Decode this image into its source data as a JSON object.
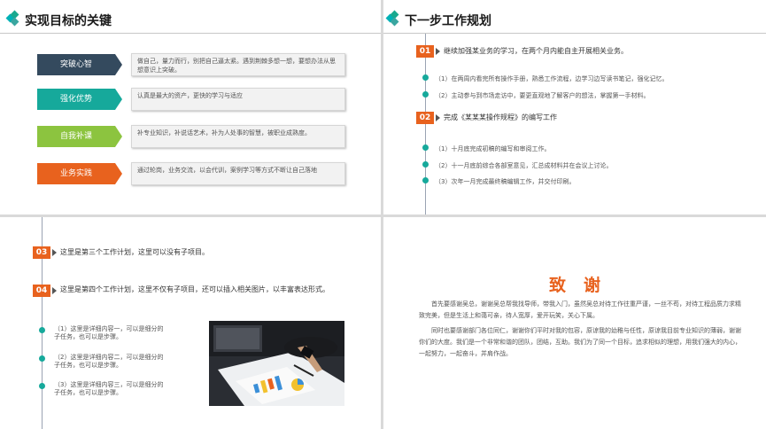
{
  "slide1": {
    "title": "实现目标的关键",
    "items": [
      {
        "label": "突破心智",
        "desc": "做自己，量力而行，别把自己逼太紧。遇到荆棘多想一想，要想办法从思想意识上突破。",
        "color": "#344a5e"
      },
      {
        "label": "强化优势",
        "desc": "认真是最大的资产，更快的学习与适应",
        "color": "#16a99b"
      },
      {
        "label": "自我补课",
        "desc": "补专业知识，补说话艺术，补为人处事的智慧，被职业成熟度。",
        "color": "#8cc43f"
      },
      {
        "label": "业务实践",
        "desc": "通过轮岗，业务交流，以会代训，案例学习等方式不断让自己落地",
        "color": "#e8621e"
      }
    ]
  },
  "slide2": {
    "title": "下一步工作规划",
    "sections": [
      {
        "num": "01",
        "heading": "继续加强某业务的学习，在两个月内能自主开展相关业务。",
        "items": [
          "（1）在两周内看完所有操作手册，熟悉工作流程，边学习边写读书笔记，强化记忆。",
          "（2）主动参与到市场走访中，要更直观地了解客户的想法，掌握第一手材料。"
        ]
      },
      {
        "num": "02",
        "heading": "完成《某某某操作规程》的编写工作",
        "items": [
          "（1）十月底完成初稿的编写和审阅工作。",
          "（2）十一月底前综合各部室意见，汇总成材料并在会议上讨论。",
          "（3）次年一月完成最终稿编辑工作，并交付印刷。"
        ]
      }
    ]
  },
  "slide3": {
    "sections": [
      {
        "num": "03",
        "text": "这里是第三个工作计划，这里可以没有子项目。"
      },
      {
        "num": "04",
        "text": "这里是第四个工作计划，这里不仅有子项目，还可以插入相关图片，以丰富表达形式。"
      }
    ],
    "items": [
      "（1）这里是详细内容一，可以是细分的子任务，也可以是步骤。",
      "（2）这里是详细内容二，可以是细分的子任务，也可以是步骤。",
      "（3）这里是详细内容三，可以是细分的子任务，也可以是步骤。"
    ]
  },
  "slide4": {
    "thanks": "致谢",
    "paragraphs": [
      "首先要感谢吴总，谢谢吴总帮我找导师，带我入门，虽然吴总对待工作往重严谨，一丝不苟，对待工程品质力求精致完美，但是生活上和蔼可亲，待人宽厚，爱开玩笑，关心下属。",
      "同时也要感谢部门各位同仁，谢谢你们平时对我的包容，原谅我的幼稚与任性，原谅我目前专业知识的薄弱，谢谢你们的大度。我们是一个非常和谐的团队，团结，互助。我们为了同一个目标，追求相似的理想，用我们强大的内心，一起努力，一起奋斗，并肩作战。"
    ]
  }
}
